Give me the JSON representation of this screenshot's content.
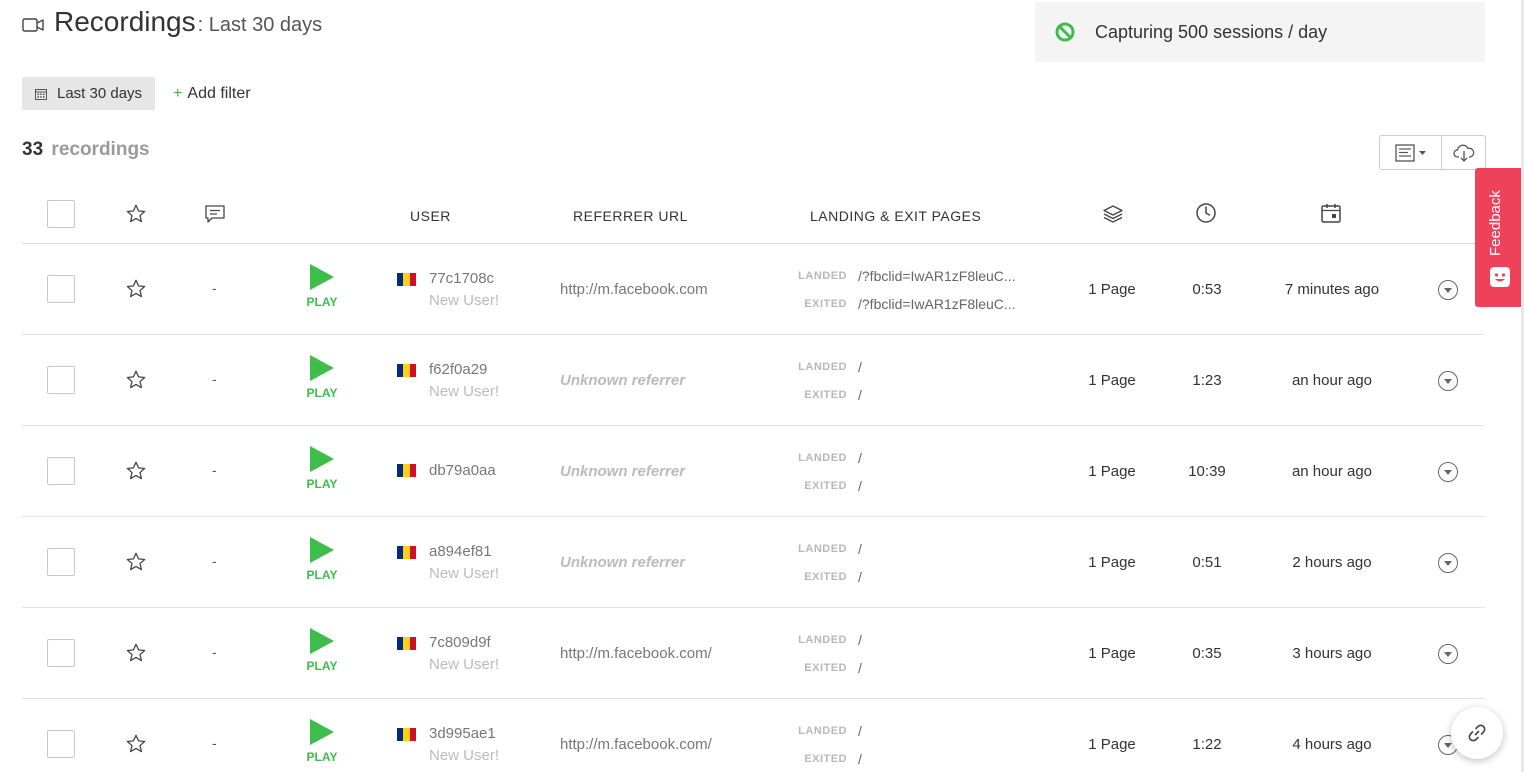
{
  "header": {
    "title": "Recordings",
    "subtitle": ": Last 30 days",
    "icon": "video-camera-icon"
  },
  "capture": {
    "text": "Capturing 500 sessions / day",
    "icon": "no-entry-icon",
    "icon_color": "#3dbd4a"
  },
  "filters": {
    "date_label": "Last 30 days",
    "add_filter_plus": "+",
    "add_filter_label": "Add filter"
  },
  "summary": {
    "count": "33",
    "label": "recordings"
  },
  "columns": {
    "user": "USER",
    "referrer": "REFERRER URL",
    "pages": "LANDING & EXIT PAGES"
  },
  "labels": {
    "play": "PLAY",
    "landed": "LANDED",
    "exited": "EXITED"
  },
  "feedback": {
    "label": "Feedback",
    "color": "#f0415b"
  },
  "colors": {
    "accent_green": "#3dbd4a",
    "flag": [
      "#002b7f",
      "#fcd116",
      "#ce1126"
    ]
  },
  "rows": [
    {
      "comment": "-",
      "user_id": "77c1708c",
      "user_note": "New User!",
      "referrer": "http://m.facebook.com",
      "referrer_unknown": false,
      "landed": "/?fbclid=IwAR1zF8leuC...",
      "exited": "/?fbclid=IwAR1zF8leuC...",
      "pages": "1 Page",
      "duration": "0:53",
      "when": "7 minutes ago"
    },
    {
      "comment": "-",
      "user_id": "f62f0a29",
      "user_note": "New User!",
      "referrer": "Unknown referrer",
      "referrer_unknown": true,
      "landed": "/",
      "exited": "/",
      "pages": "1 Page",
      "duration": "1:23",
      "when": "an hour ago"
    },
    {
      "comment": "-",
      "user_id": "db79a0aa",
      "user_note": "",
      "referrer": "Unknown referrer",
      "referrer_unknown": true,
      "landed": "/",
      "exited": "/",
      "pages": "1 Page",
      "duration": "10:39",
      "when": "an hour ago"
    },
    {
      "comment": "-",
      "user_id": "a894ef81",
      "user_note": "New User!",
      "referrer": "Unknown referrer",
      "referrer_unknown": true,
      "landed": "/",
      "exited": "/",
      "pages": "1 Page",
      "duration": "0:51",
      "when": "2 hours ago"
    },
    {
      "comment": "-",
      "user_id": "7c809d9f",
      "user_note": "New User!",
      "referrer": "http://m.facebook.com/",
      "referrer_unknown": false,
      "landed": "/",
      "exited": "/",
      "pages": "1 Page",
      "duration": "0:35",
      "when": "3 hours ago"
    },
    {
      "comment": "-",
      "user_id": "3d995ae1",
      "user_note": "New User!",
      "referrer": "http://m.facebook.com/",
      "referrer_unknown": false,
      "landed": "/",
      "exited": "/",
      "pages": "1 Page",
      "duration": "1:22",
      "when": "4 hours ago"
    }
  ]
}
